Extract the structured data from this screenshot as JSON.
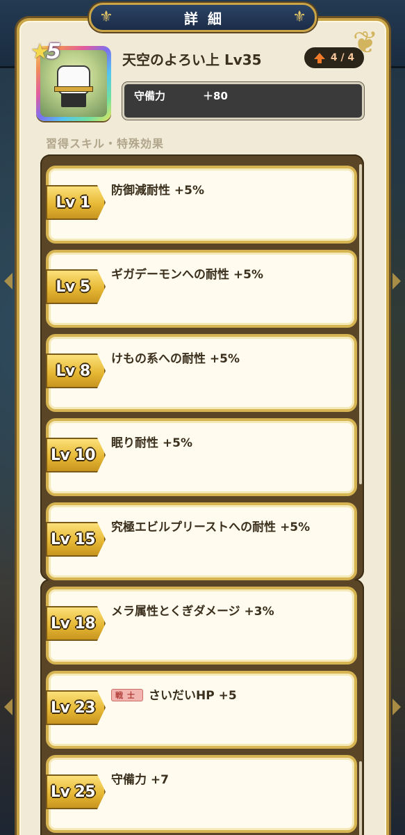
{
  "header": {
    "title": "詳細",
    "item_name": "天空のよろい上 Lv35",
    "rarity": "5",
    "upgrade": "4 / 4",
    "stat": {
      "label": "守備力",
      "value": "＋80"
    }
  },
  "section_label": "習得スキル・特殊効果",
  "skills": [
    {
      "level": "Lv 1",
      "text": "防御減耐性 +5%"
    },
    {
      "level": "Lv 5",
      "text": "ギガデーモンへの耐性 +5%"
    },
    {
      "level": "Lv 8",
      "text": "けもの系への耐性 +5%"
    },
    {
      "level": "Lv 10",
      "text": "眠り耐性 +5%"
    },
    {
      "level": "Lv 15",
      "text": "究極エビルプリーストへの耐性 +5%"
    },
    {
      "level": "Lv 18",
      "text": "メラ属性とくぎダメージ +3%"
    },
    {
      "level": "Lv 23",
      "tag": "戦士",
      "text": "さいだいHP +5"
    },
    {
      "level": "Lv 25",
      "text": "守備力 +7"
    }
  ],
  "colors": {
    "panel": "#f1ead7",
    "gold": "#c9a548",
    "title_plate": "#1b2c47",
    "text": "#3b2f1d"
  }
}
